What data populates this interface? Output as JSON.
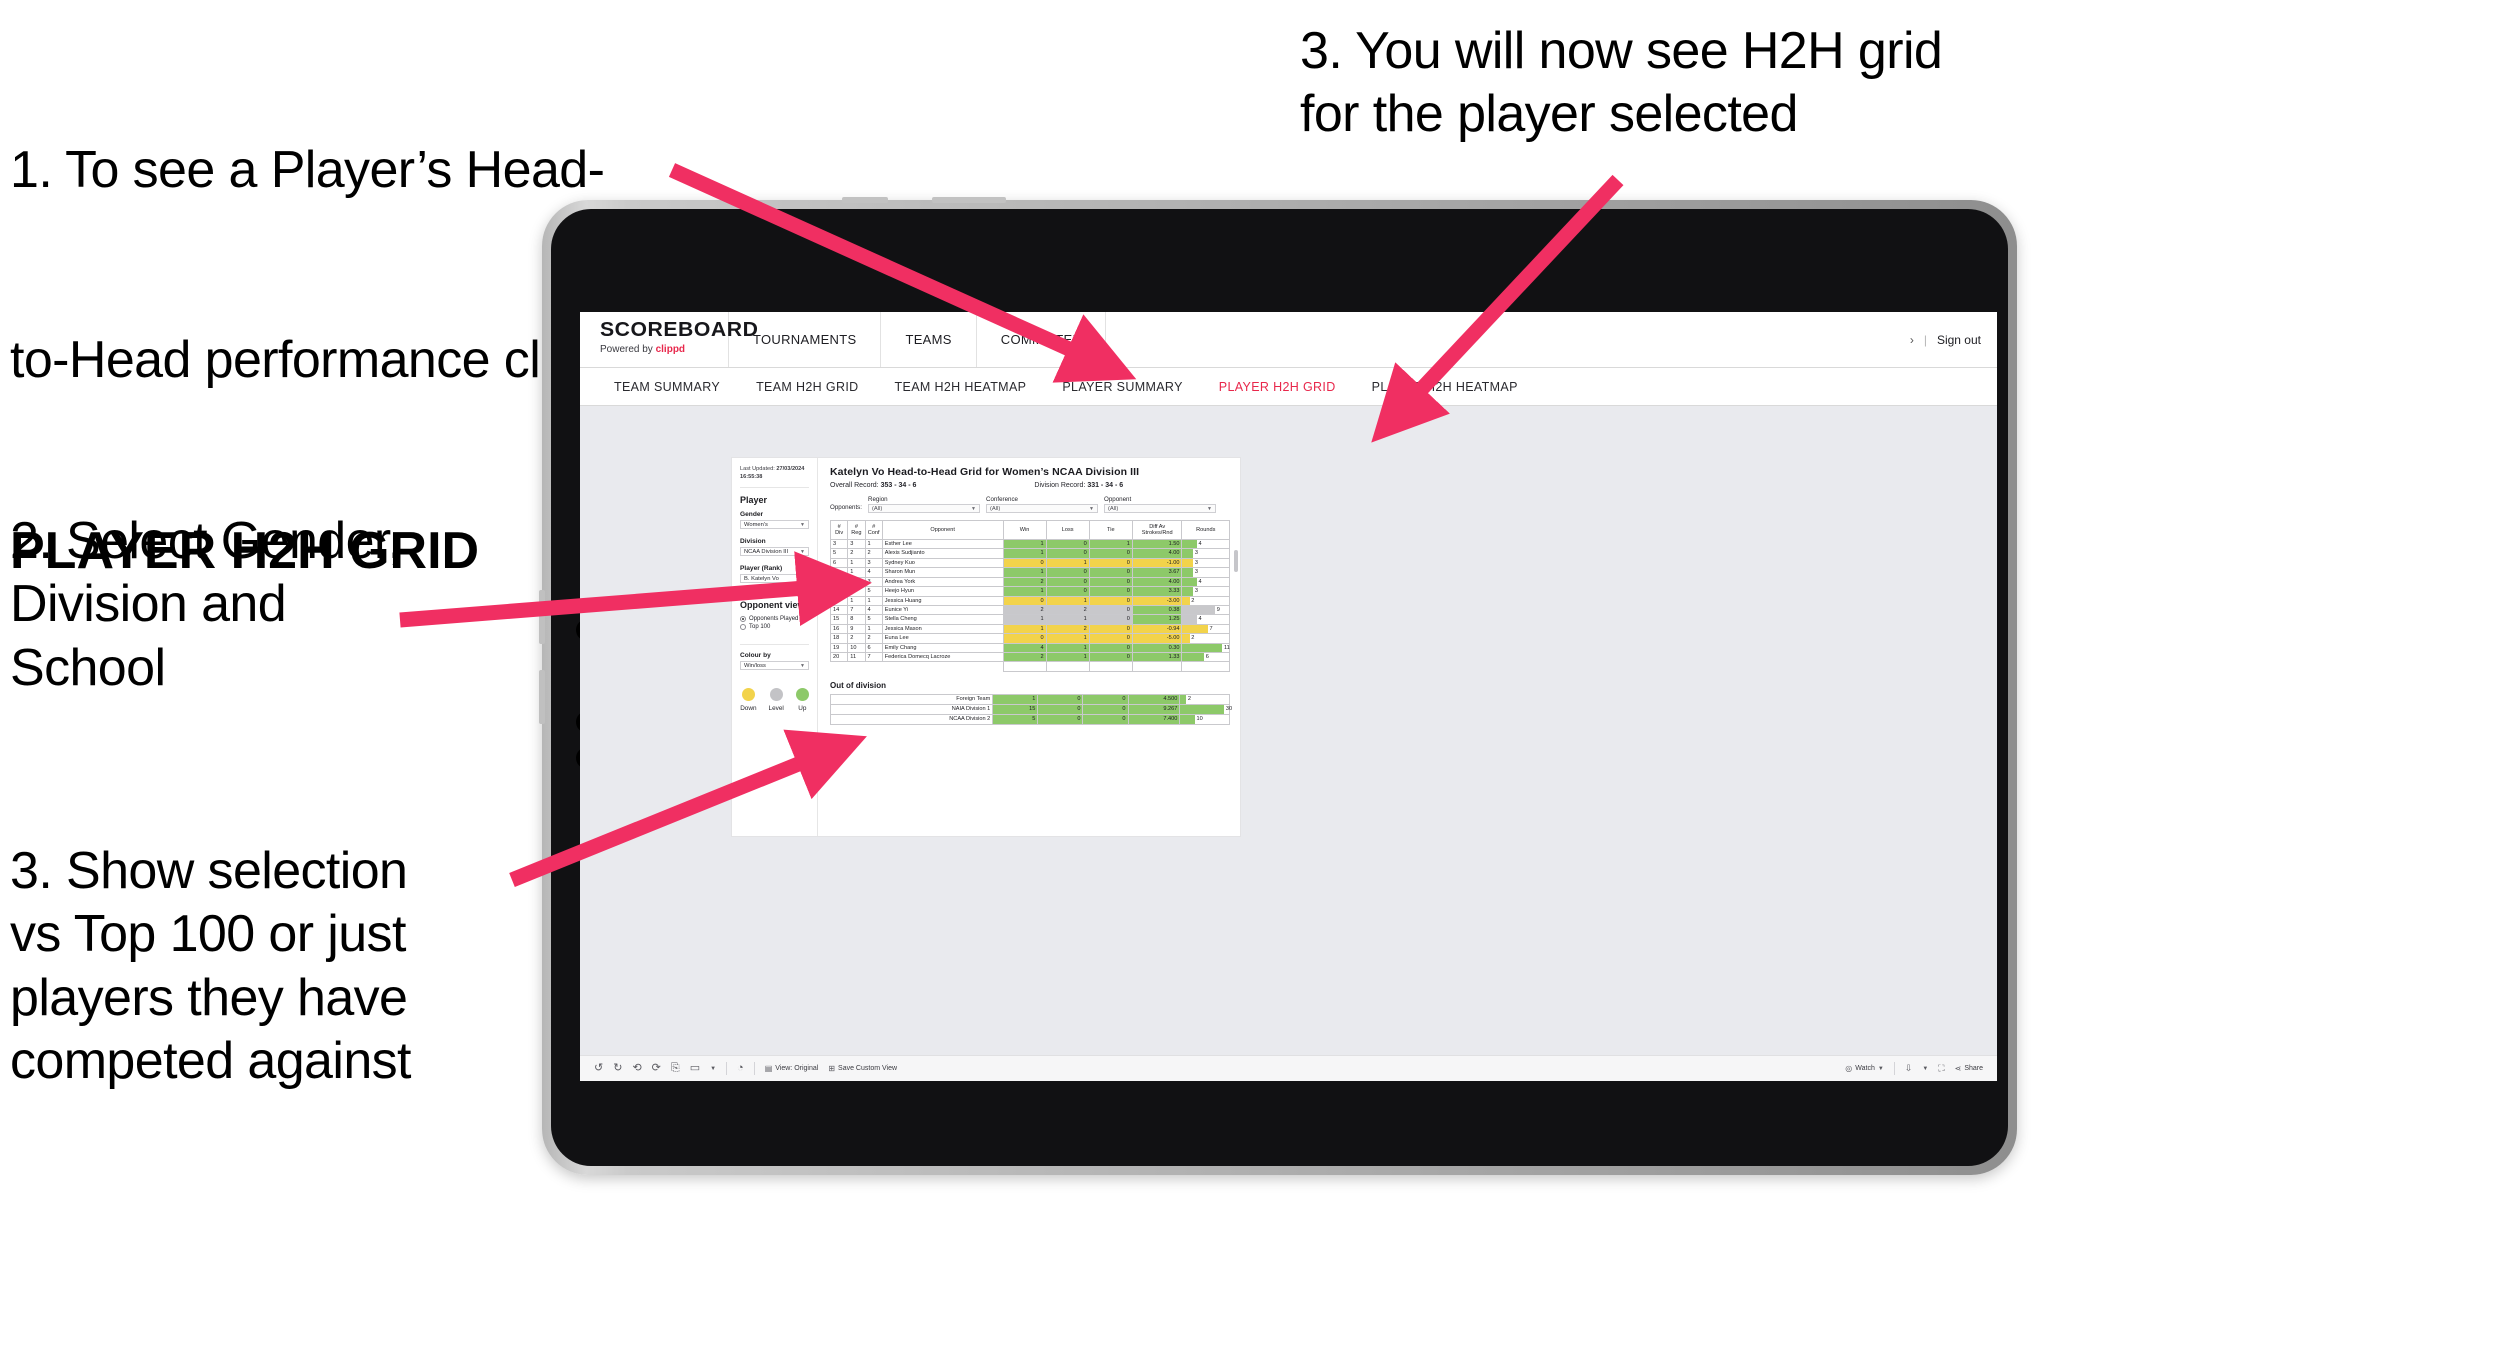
{
  "annotations": [
    {
      "id": "anno1",
      "line1": "1. To see a Player’s Head-",
      "line2": "to-Head performance click",
      "bold": "PLAYER H2H GRID"
    },
    {
      "id": "anno2",
      "text": "2. Select Gender,\nDivision and\nSchool"
    },
    {
      "id": "anno3",
      "text": "3. Show selection\nvs Top 100 or just\nplayers they have\ncompeted against"
    },
    {
      "id": "anno4",
      "text": "3. You will now see H2H grid\nfor the player selected"
    }
  ],
  "app": {
    "brand": {
      "name": "SCOREBOARD",
      "powered_prefix": "Powered by ",
      "powered_name": "clippd"
    },
    "top_nav": [
      "TOURNAMENTS",
      "TEAMS",
      "COMMITTEE"
    ],
    "header_right": {
      "chevron": "›",
      "separator": "|",
      "sign_out": "Sign out"
    },
    "tabs": [
      {
        "label": "TEAM SUMMARY",
        "active": false
      },
      {
        "label": "TEAM H2H GRID",
        "active": false
      },
      {
        "label": "TEAM H2H HEATMAP",
        "active": false
      },
      {
        "label": "PLAYER SUMMARY",
        "active": false
      },
      {
        "label": "PLAYER H2H GRID",
        "active": true
      },
      {
        "label": "PLAYER H2H HEATMAP",
        "active": false
      }
    ]
  },
  "panel": {
    "last_updated_label": "Last Updated: ",
    "last_updated_value": "27/03/2024 16:55:38",
    "player_heading": "Player",
    "filters": [
      {
        "label": "Gender",
        "value": "Women's"
      },
      {
        "label": "Division",
        "value": "NCAA Division III"
      },
      {
        "label": "Player (Rank)",
        "value": "B. Katelyn Vo"
      }
    ],
    "opponent_view": {
      "heading": "Opponent view",
      "options": [
        {
          "label": "Opponents Played",
          "selected": true
        },
        {
          "label": "Top 100",
          "selected": false
        }
      ]
    },
    "colour_by": {
      "label": "Colour by",
      "value": "Win/loss"
    },
    "legend": [
      {
        "label": "Down",
        "color": "#F2D34B"
      },
      {
        "label": "Level",
        "color": "#C3C3C6"
      },
      {
        "label": "Up",
        "color": "#8DC969"
      }
    ]
  },
  "main": {
    "title": "Katelyn Vo Head-to-Head Grid for Women’s NCAA Division III",
    "overall_record_label": "Overall Record: ",
    "overall_record_value": "353 - 34 - 6",
    "division_record_label": "Division Record: ",
    "division_record_value": "331 - 34 - 6",
    "opponents_label": "Opponents:",
    "opponent_filters": [
      {
        "title": "Region",
        "value": "(All)"
      },
      {
        "title": "Conference",
        "value": "(All)"
      },
      {
        "title": "Opponent",
        "value": "(All)"
      }
    ],
    "out_of_division_title": "Out of division"
  },
  "chart_data": {
    "type": "table",
    "title": "Katelyn Vo Head-to-Head Grid for Women’s NCAA Division III",
    "columns": [
      "# Div",
      "# Reg",
      "# Conf",
      "Opponent",
      "Win",
      "Loss",
      "Tie",
      "Diff Av Strokes/Rnd",
      "Rounds"
    ],
    "column_header_lines": [
      [
        "#",
        "Div"
      ],
      [
        "#",
        "Reg"
      ],
      [
        "#",
        "Conf"
      ],
      [
        "Opponent"
      ],
      [
        "Win"
      ],
      [
        "Loss"
      ],
      [
        "Tie"
      ],
      [
        "Diff Av",
        "Strokes/Rnd"
      ],
      [
        "Rounds"
      ]
    ],
    "rows": [
      {
        "div": "3",
        "reg": "3",
        "conf": "1",
        "opponent": "Esther Lee",
        "win": "1",
        "loss": "0",
        "tie": "1",
        "diff": "1.50",
        "rounds": "4",
        "state": "up"
      },
      {
        "div": "5",
        "reg": "2",
        "conf": "2",
        "opponent": "Alexis Sudjianto",
        "win": "1",
        "loss": "0",
        "tie": "0",
        "diff": "4.00",
        "rounds": "3",
        "state": "up"
      },
      {
        "div": "6",
        "reg": "1",
        "conf": "3",
        "opponent": "Sydney Kuo",
        "win": "0",
        "loss": "1",
        "tie": "0",
        "diff": "-1.00",
        "rounds": "3",
        "state": "down"
      },
      {
        "div": "9",
        "reg": "1",
        "conf": "4",
        "opponent": "Sharon Mun",
        "win": "1",
        "loss": "0",
        "tie": "0",
        "diff": "3.67",
        "rounds": "3",
        "state": "up"
      },
      {
        "div": "10",
        "reg": "6",
        "conf": "3",
        "opponent": "Andrea York",
        "win": "2",
        "loss": "0",
        "tie": "0",
        "diff": "4.00",
        "rounds": "4",
        "state": "up"
      },
      {
        "div": "11",
        "reg": "2",
        "conf": "5",
        "opponent": "Heejo Hyun",
        "win": "1",
        "loss": "0",
        "tie": "0",
        "diff": "3.33",
        "rounds": "3",
        "state": "up"
      },
      {
        "div": "13",
        "reg": "1",
        "conf": "1",
        "opponent": "Jessica Huang",
        "win": "0",
        "loss": "1",
        "tie": "0",
        "diff": "-3.00",
        "rounds": "2",
        "state": "down"
      },
      {
        "div": "14",
        "reg": "7",
        "conf": "4",
        "opponent": "Eunice Yi",
        "win": "2",
        "loss": "2",
        "tie": "0",
        "diff": "0.38",
        "rounds": "9",
        "state": "level"
      },
      {
        "div": "15",
        "reg": "8",
        "conf": "5",
        "opponent": "Stella Cheng",
        "win": "1",
        "loss": "1",
        "tie": "0",
        "diff": "1.25",
        "rounds": "4",
        "state": "level"
      },
      {
        "div": "16",
        "reg": "9",
        "conf": "1",
        "opponent": "Jessica Mason",
        "win": "1",
        "loss": "2",
        "tie": "0",
        "diff": "-0.94",
        "rounds": "7",
        "state": "down"
      },
      {
        "div": "18",
        "reg": "2",
        "conf": "2",
        "opponent": "Euna Lee",
        "win": "0",
        "loss": "1",
        "tie": "0",
        "diff": "-5.00",
        "rounds": "2",
        "state": "down"
      },
      {
        "div": "19",
        "reg": "10",
        "conf": "6",
        "opponent": "Emily Chang",
        "win": "4",
        "loss": "1",
        "tie": "0",
        "diff": "0.30",
        "rounds": "11",
        "state": "up"
      },
      {
        "div": "20",
        "reg": "11",
        "conf": "7",
        "opponent": "Federica Domecq Lacroze",
        "win": "2",
        "loss": "1",
        "tie": "0",
        "diff": "1.33",
        "rounds": "6",
        "state": "up"
      }
    ],
    "out_of_division_rows": [
      {
        "name": "Foreign Team",
        "win": "1",
        "loss": "0",
        "tie": "0",
        "diff": "4.500",
        "rounds": "2",
        "state": "up"
      },
      {
        "name": "NAIA Division 1",
        "win": "15",
        "loss": "0",
        "tie": "0",
        "diff": "9.267",
        "rounds": "30",
        "state": "up"
      },
      {
        "name": "NCAA Division 2",
        "win": "5",
        "loss": "0",
        "tie": "0",
        "diff": "7.400",
        "rounds": "10",
        "state": "up"
      }
    ],
    "colors": {
      "up": "#8DC969",
      "down": "#F2D34B",
      "level": "#C8C8CB",
      "accent": "#E8274B",
      "arrow": "#F02F62"
    }
  },
  "toolbar": {
    "view_label": "View: Original",
    "save_label": "Save Custom View",
    "watch_label": "Watch",
    "share_label": "Share",
    "icons": [
      "undo-icon",
      "redo-icon",
      "revert-icon",
      "refresh-icon",
      "pause-icon",
      "zoom-icon",
      "dropdown-caret-icon",
      "highlight-icon"
    ]
  }
}
